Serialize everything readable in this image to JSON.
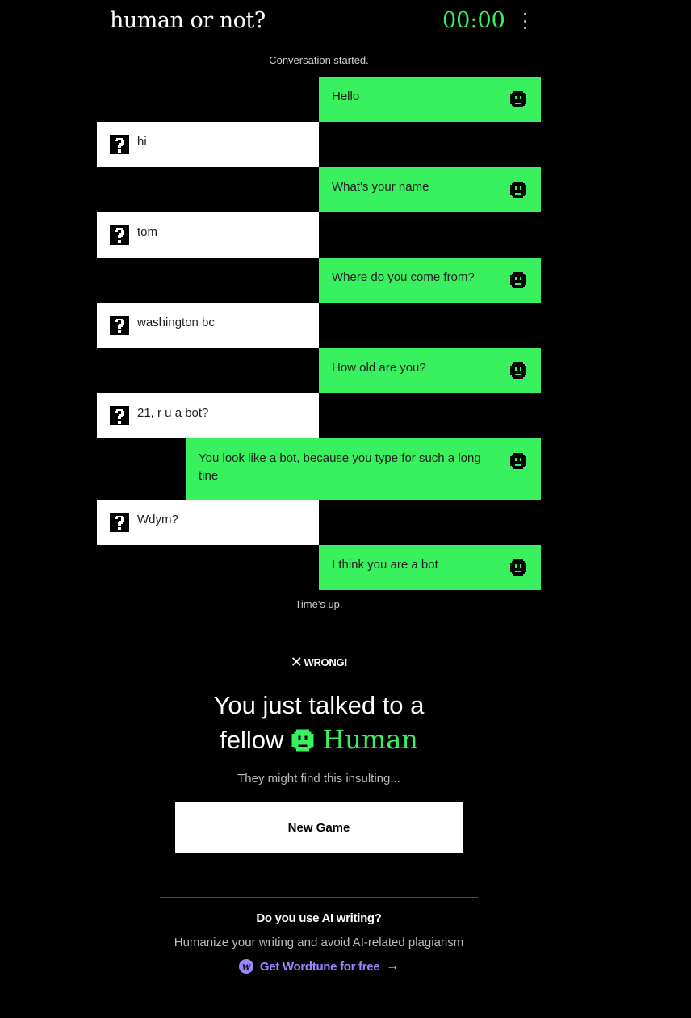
{
  "header": {
    "title": "human or not?",
    "timer": "00:00"
  },
  "chat": {
    "start_notice": "Conversation started.",
    "end_notice": "Time's up.",
    "messages": [
      {
        "sender": "bot",
        "text": "Hello"
      },
      {
        "sender": "human",
        "text": "hi"
      },
      {
        "sender": "bot",
        "text": "What's your name"
      },
      {
        "sender": "human",
        "text": "tom"
      },
      {
        "sender": "bot",
        "text": "Where do you come from?"
      },
      {
        "sender": "human",
        "text": "washington bc"
      },
      {
        "sender": "bot",
        "text": "How old are you?"
      },
      {
        "sender": "human",
        "text": "21, r u a bot?"
      },
      {
        "sender": "bot",
        "text": "You look like a bot, because you type for such a long tine"
      },
      {
        "sender": "human",
        "text": "Wdym?"
      },
      {
        "sender": "bot",
        "text": "I think you are a bot"
      }
    ]
  },
  "result": {
    "verdict_icon": "✕",
    "verdict": "WRONG!",
    "headline_line1": "You just talked to a",
    "headline_prefix": "fellow",
    "headline_highlight": "Human",
    "subtext": "They might find this insulting...",
    "button_label": "New Game"
  },
  "promo": {
    "title": "Do you use AI writing?",
    "text": "Humanize your writing and avoid AI-related plagiarism",
    "link_label": "Get Wordtune for free",
    "link_icon": "w",
    "arrow": "→"
  },
  "colors": {
    "accent_green": "#39f05f",
    "promo_purple": "#9b86ff",
    "background": "#000000"
  }
}
